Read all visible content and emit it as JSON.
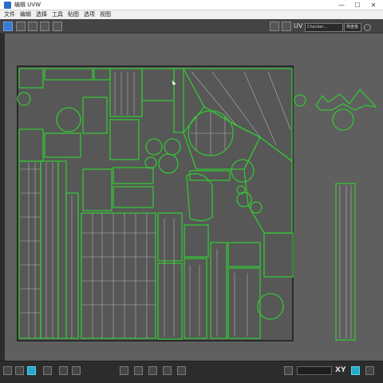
{
  "window": {
    "title": "编辑 UVW",
    "controls": [
      "—",
      "☐",
      "✕"
    ]
  },
  "menubar": {
    "items": [
      "文件",
      "编辑",
      "选择",
      "工具",
      "贴图",
      "选项",
      "视图"
    ]
  },
  "toolbar": {
    "uv_label": "UV",
    "checker_map": "Checker…",
    "map_select": "棋盘格"
  },
  "bottombar": {
    "xy_label": "XY"
  },
  "colors": {
    "uv_wire": "#35c435",
    "uv_wire_inner": "#e8e8e8",
    "accent": "#3b7ad1"
  }
}
